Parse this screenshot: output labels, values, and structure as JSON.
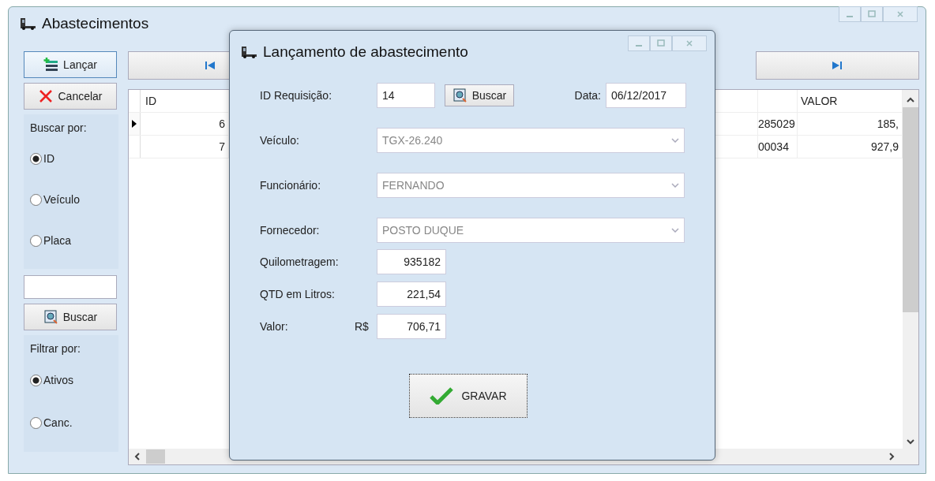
{
  "window": {
    "title": "Abastecimentos"
  },
  "sidebar": {
    "launch_button": "Lançar",
    "cancel_button": "Cancelar",
    "search_by": {
      "label": "Buscar por:",
      "options": [
        {
          "label": "ID",
          "selected": true
        },
        {
          "label": "Veículo",
          "selected": false
        },
        {
          "label": "Placa",
          "selected": false
        }
      ]
    },
    "search_button": "Buscar",
    "filter_by": {
      "label": "Filtrar por:",
      "options": [
        {
          "label": "Ativos",
          "selected": true
        },
        {
          "label": "Canc.",
          "selected": false
        }
      ]
    }
  },
  "table": {
    "columns": [
      {
        "label": "ID"
      },
      {
        "label": "VALOR"
      }
    ],
    "rows": [
      {
        "current": true,
        "id": "6",
        "column_4": "285029",
        "valor": "185,"
      },
      {
        "current": false,
        "id": "7",
        "column_4": "00034",
        "valor": "927,9"
      }
    ]
  },
  "dialog": {
    "title": "Lançamento de abastecimento",
    "requisition": {
      "label": "ID Requisição:",
      "value": "14",
      "button": "Buscar"
    },
    "date": {
      "label": "Data:",
      "value": "06/12/2017"
    },
    "combos": [
      {
        "label": "Veículo:",
        "value": "TGX-26.240",
        "disabled": true
      },
      {
        "label": "Funcionário:",
        "value": "FERNANDO",
        "disabled": true
      },
      {
        "label": "Fornecedor:",
        "value": "POSTO DUQUE",
        "disabled": true
      }
    ],
    "numbers": [
      {
        "label": "Quilometragem:",
        "value": "935182"
      },
      {
        "label": "QTD em Litros:",
        "value": "221,54"
      },
      {
        "label": "Valor:",
        "prefix": "R$",
        "value": "706,71"
      }
    ],
    "save_button": "GRAVAR"
  }
}
